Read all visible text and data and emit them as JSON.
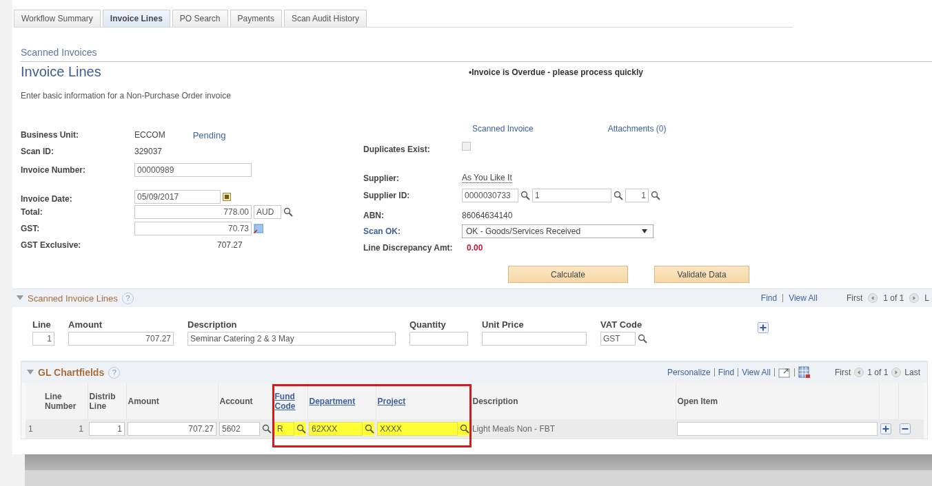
{
  "tabs": [
    {
      "label": "Workflow Summary",
      "selected": false
    },
    {
      "label": "Invoice Lines",
      "selected": true
    },
    {
      "label": "PO Search",
      "selected": false
    },
    {
      "label": "Payments",
      "selected": false
    },
    {
      "label": "Scan Audit History",
      "selected": false
    }
  ],
  "breadcrumb": "Scanned Invoices",
  "page_title": "Invoice Lines",
  "notice": "•Invoice is Overdue - please process quickly",
  "instructions": "Enter basic information for a Non-Purchase Order invoice",
  "status": "Pending",
  "header_links": [
    "Scanned Invoice",
    "Attachments (0)"
  ],
  "left_fields": [
    {
      "kind": "text",
      "label": "Business Unit:",
      "value": "ECCOM"
    },
    {
      "kind": "text",
      "label": "Scan ID:",
      "value": "329037"
    },
    {
      "kind": "input",
      "label": "Invoice Number:",
      "value": "00000989"
    },
    {
      "kind": "date",
      "label": "Invoice Date:",
      "value": "05/09/2017"
    },
    {
      "kind": "amount_currency",
      "label": "Total:",
      "value": "778.00",
      "currency": "AUD"
    },
    {
      "kind": "amount_note",
      "label": "GST:",
      "value": "70.73"
    },
    {
      "kind": "amount_text",
      "label": "GST Exclusive:",
      "value": "707.27"
    }
  ],
  "right_fields": [
    {
      "kind": "checkbox",
      "label": "Duplicates Exist:",
      "checked": false
    },
    {
      "kind": "dotted_text",
      "label": "Supplier:",
      "value": "As You Like It"
    },
    {
      "kind": "supplier_id",
      "label": "Supplier ID:",
      "values": [
        "0000030733",
        "1",
        "1"
      ]
    },
    {
      "kind": "text",
      "label": "ABN:",
      "value": "86064634140"
    },
    {
      "kind": "select",
      "label": "Scan OK:",
      "label_is_link": true,
      "value": "OK - Goods/Services Received"
    },
    {
      "kind": "red_amount",
      "label": "Line Discrepancy Amt:",
      "value": "0.00"
    }
  ],
  "buttons": [
    "Calculate",
    "Validate Data"
  ],
  "invoice_lines": {
    "title": "Scanned Invoice Lines",
    "expanded": true,
    "nav": {
      "links": [
        "Find",
        "View All"
      ],
      "first": "First",
      "count": "1 of 1",
      "last": "L"
    },
    "help": "?",
    "fields": [
      {
        "label": "Line",
        "value": "1"
      },
      {
        "label": "Amount",
        "value": "707.27"
      },
      {
        "label": "Description",
        "value": "Seminar Catering 2 & 3 May"
      },
      {
        "label": "Quantity"
      },
      {
        "label": "Unit Price"
      },
      {
        "label": "VAT Code",
        "value": "GST",
        "lookup": true
      }
    ]
  },
  "gl_chartfields": {
    "title": "GL Chartfields",
    "expanded": true,
    "help": "?",
    "nav": {
      "links": [
        "Personalize",
        "Find",
        "View All"
      ],
      "first": "First",
      "count": "1 of 1",
      "last": "Last"
    },
    "columns": [
      {
        "label": "Line Number",
        "link": false
      },
      {
        "label": "Distrib Line",
        "link": false
      },
      {
        "label": "Amount",
        "link": false
      },
      {
        "label": "Account",
        "link": false
      },
      {
        "label": "Fund Code",
        "link": true
      },
      {
        "label": "Department",
        "link": true
      },
      {
        "label": "Project",
        "link": true
      },
      {
        "label": "Description",
        "link": false
      },
      {
        "label": "Open Item",
        "link": false
      }
    ],
    "rows": [
      {
        "cells": [
          {
            "kind": "pair",
            "values": [
              "1",
              "1"
            ]
          },
          {
            "kind": "input",
            "value": "1"
          },
          {
            "kind": "input",
            "value": "707.27"
          },
          {
            "kind": "lookup",
            "value": "5602",
            "highlighted": false
          },
          {
            "kind": "lookup",
            "value": "R",
            "highlighted": true
          },
          {
            "kind": "lookup",
            "value": "62XXX",
            "highlighted": true
          },
          {
            "kind": "lookup",
            "value": "XXXX",
            "highlighted": true
          },
          {
            "kind": "text",
            "value": "Light Meals Non - FBT"
          },
          {
            "kind": "input"
          },
          {
            "kind": "add"
          },
          {
            "kind": "remove"
          }
        ]
      }
    ]
  }
}
